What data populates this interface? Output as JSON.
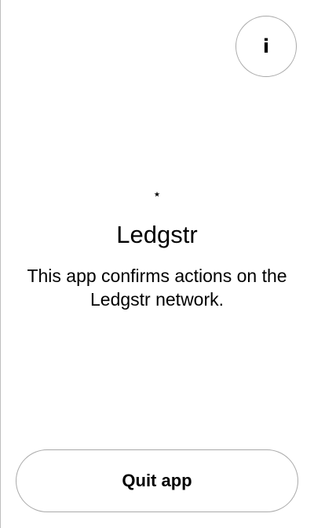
{
  "header": {
    "info_button_glyph": "i",
    "info_icon": "info-icon"
  },
  "app": {
    "icon_glyph": "⋆",
    "icon_name": "app-star-icon",
    "title": "Ledgstr",
    "description": "This app confirms actions on the Ledgstr network."
  },
  "footer": {
    "quit_label": "Quit app"
  },
  "colors": {
    "background": "#ffffff",
    "text": "#000000",
    "border": "#a9a9a9"
  }
}
